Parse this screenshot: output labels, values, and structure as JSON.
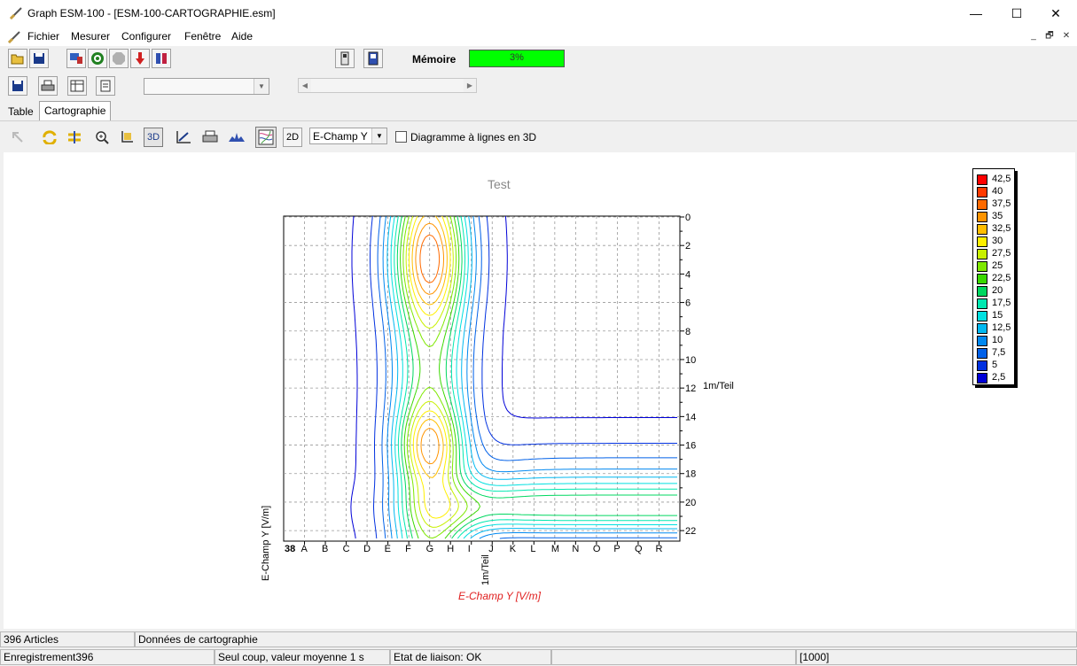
{
  "window": {
    "title": "Graph ESM-100 - [ESM-100-CARTOGRAPHIE.esm]",
    "minimize": "—",
    "maximize": "☐",
    "close": "✕"
  },
  "menu": {
    "items": [
      "Fichier",
      "Mesurer",
      "Configurer",
      "Fenêtre",
      "Aide"
    ],
    "mdi_buttons": [
      "_",
      "🗗",
      "✕"
    ]
  },
  "toolbar1": {
    "memory_label": "Mémoire",
    "memory_value": "3%",
    "memory_fraction": 1.0
  },
  "toolbar2": {
    "combo_value": ""
  },
  "tabs": [
    "Table",
    "Cartographie"
  ],
  "chart_toolbar": {
    "btn_3d": "3D",
    "btn_2d": "2D",
    "field_select": "E-Champ Y",
    "checkbox_label": "Diagramme à lignes en 3D",
    "checkbox_checked": false
  },
  "chart_data": {
    "type": "contour",
    "title": "Test",
    "xlabel": "1m/Teil",
    "ylabel": "1m/Teil",
    "zlabel": "E-Champ Y [V/m]",
    "left_axis_label": "E-Champ Y [V/m]",
    "corner_label": "38",
    "x_categories": [
      "A",
      "B",
      "C",
      "D",
      "E",
      "F",
      "G",
      "H",
      "I",
      "J",
      "K",
      "L",
      "M",
      "N",
      "O",
      "P",
      "Q",
      "R"
    ],
    "y_ticks": [
      0,
      2,
      4,
      6,
      8,
      10,
      12,
      14,
      16,
      18,
      20,
      22
    ],
    "ylim": [
      0,
      22.8
    ],
    "grid": true,
    "legend": {
      "placement": "right",
      "levels": [
        "42,5",
        "40",
        "37,5",
        "35",
        "32,5",
        "30",
        "27,5",
        "25",
        "22,5",
        "20",
        "17,5",
        "15",
        "12,5",
        "10",
        "7,5",
        "5",
        "2,5"
      ],
      "colors": [
        "#ff0000",
        "#ff3a00",
        "#ff6a00",
        "#ff9400",
        "#ffbe00",
        "#fff000",
        "#c8f000",
        "#7ee800",
        "#3ad800",
        "#00d860",
        "#00e8b0",
        "#00e0e0",
        "#00b8f0",
        "#0088f0",
        "#0060e8",
        "#0030e0",
        "#0000d8"
      ]
    }
  },
  "status": {
    "row1": [
      "396 Articles",
      "Données de cartographie"
    ],
    "row2": [
      "Enregistrement396",
      "Seul coup, valeur moyenne 1 s",
      "Etat de liaison: OK",
      "",
      "[1000]"
    ]
  }
}
